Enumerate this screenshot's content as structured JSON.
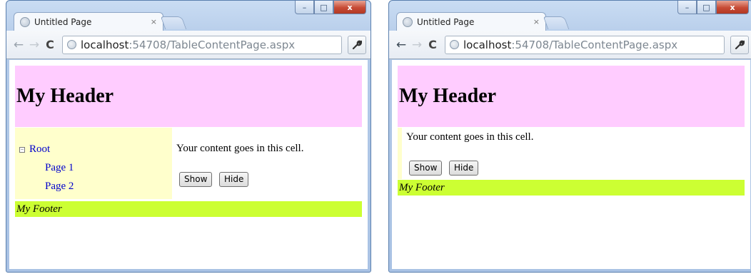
{
  "windows": [
    {
      "tab_title": "Untitled Page",
      "tab_close": "×",
      "url_host": "localhost",
      "url_rest": ":54708/TableContentPage.aspx",
      "page": {
        "header": "My Header",
        "tree": {
          "root": "Root",
          "expander": "⊟",
          "children": [
            "Page 1",
            "Page 2"
          ]
        },
        "content": "Your content goes in this cell.",
        "buttons": {
          "show": "Show",
          "hide": "Hide"
        },
        "footer": "My Footer"
      }
    },
    {
      "tab_title": "Untitled Page",
      "tab_close": "×",
      "url_host": "localhost",
      "url_rest": ":54708/TableContentPage.aspx",
      "page": {
        "header": "My Header",
        "content": "Your content goes in this cell.",
        "buttons": {
          "show": "Show",
          "hide": "Hide"
        },
        "footer": "My Footer"
      }
    }
  ],
  "nav": {
    "back": "←",
    "forward": "→",
    "reload": "C"
  },
  "caption": {
    "minimize": "–",
    "maximize": "□",
    "close": "x"
  },
  "colors": {
    "header_bg": "#ffccff",
    "nav_bg": "#ffffcc",
    "footer_bg": "#ccff33",
    "link": "#0000cc"
  }
}
